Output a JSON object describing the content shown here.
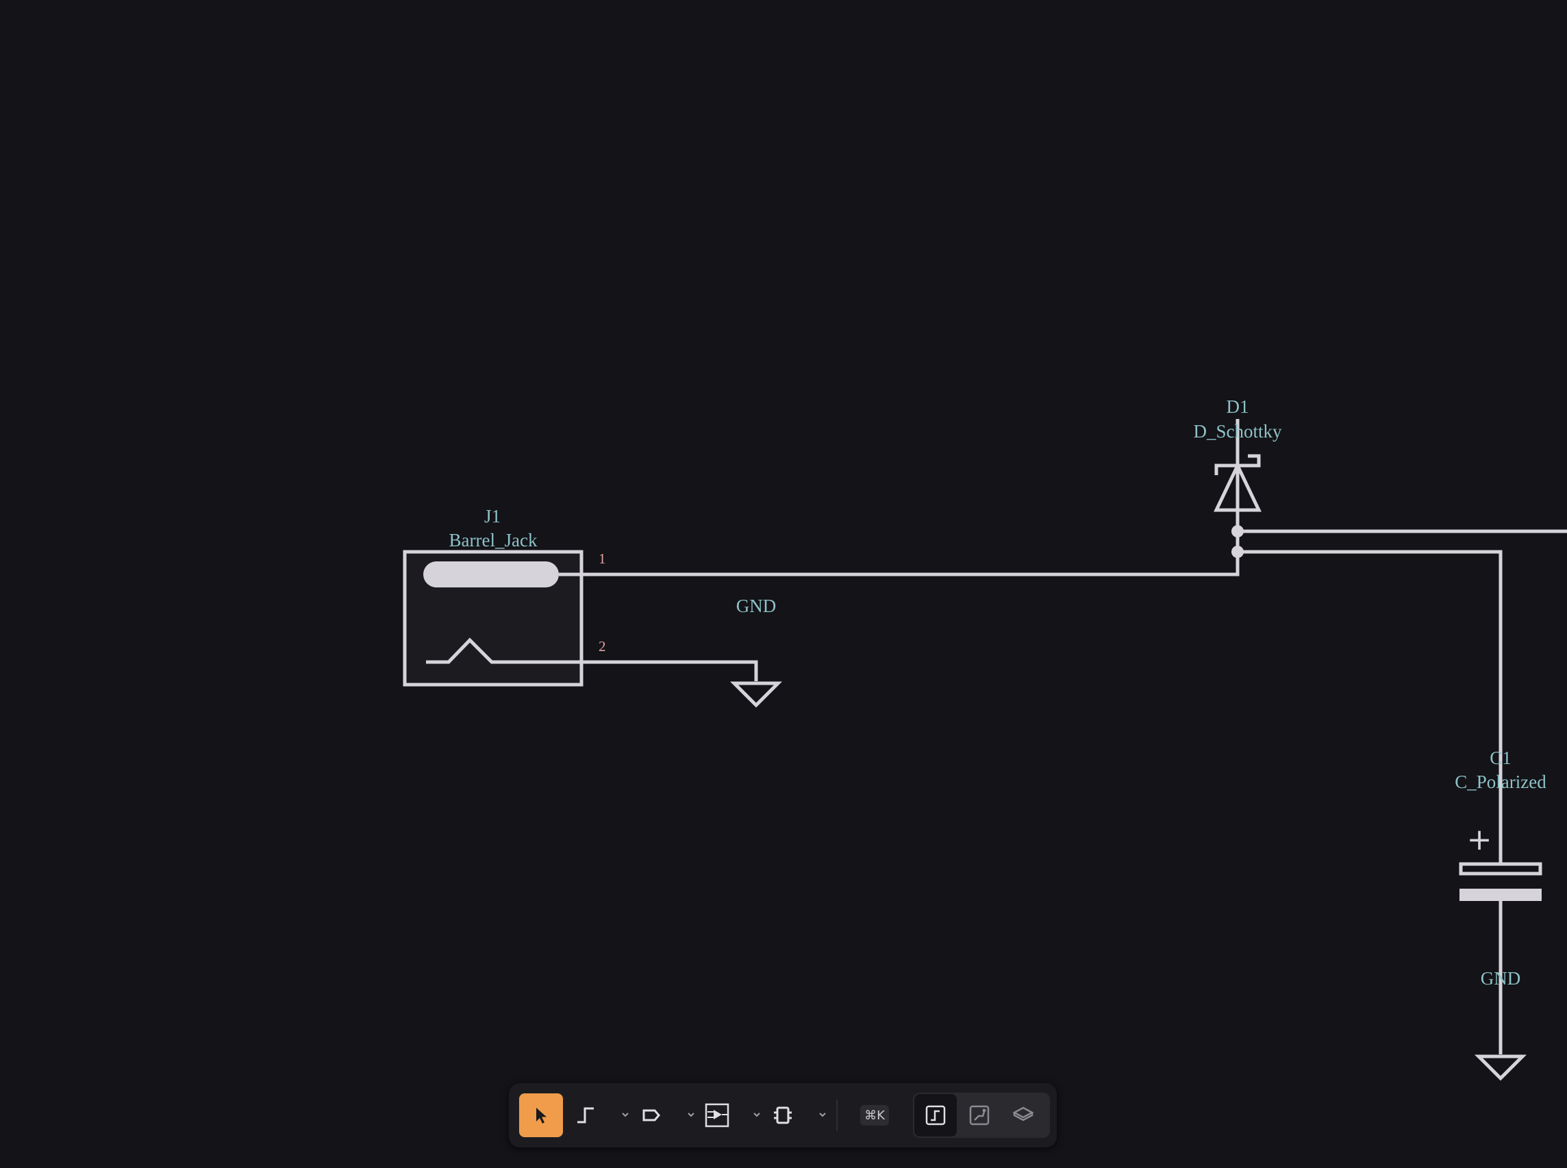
{
  "schematic": {
    "components": [
      {
        "ref": "J1",
        "value": "Barrel_Jack",
        "pins": [
          "1",
          "2"
        ]
      },
      {
        "ref": "D1",
        "value": "D_Schottky"
      },
      {
        "ref": "C1",
        "value": "C_Polarized",
        "polarity_mark": "+"
      }
    ],
    "net_labels": [
      "GND",
      "GND"
    ]
  },
  "toolbar": {
    "tools": [
      {
        "name": "select",
        "icon": "cursor-arrow-icon",
        "active": true
      },
      {
        "name": "wire",
        "icon": "wire-icon",
        "has_dropdown": true
      },
      {
        "name": "net-label",
        "icon": "net-label-icon",
        "has_dropdown": true
      },
      {
        "name": "place-symbol",
        "icon": "symbol-icon",
        "has_dropdown": true
      },
      {
        "name": "chip",
        "icon": "chip-icon",
        "has_dropdown": true
      }
    ],
    "shortcut_label": "⌘K",
    "views": [
      {
        "name": "schematic",
        "icon": "schematic-view-icon",
        "active": true
      },
      {
        "name": "pcb",
        "icon": "pcb-view-icon"
      },
      {
        "name": "3d",
        "icon": "3d-view-icon"
      }
    ]
  },
  "colors": {
    "background": "#131318",
    "wire": "#d6d4da",
    "label": "#8ec2c7",
    "pin_number": "#e6a3a3",
    "active_tool": "#f09c4a"
  }
}
